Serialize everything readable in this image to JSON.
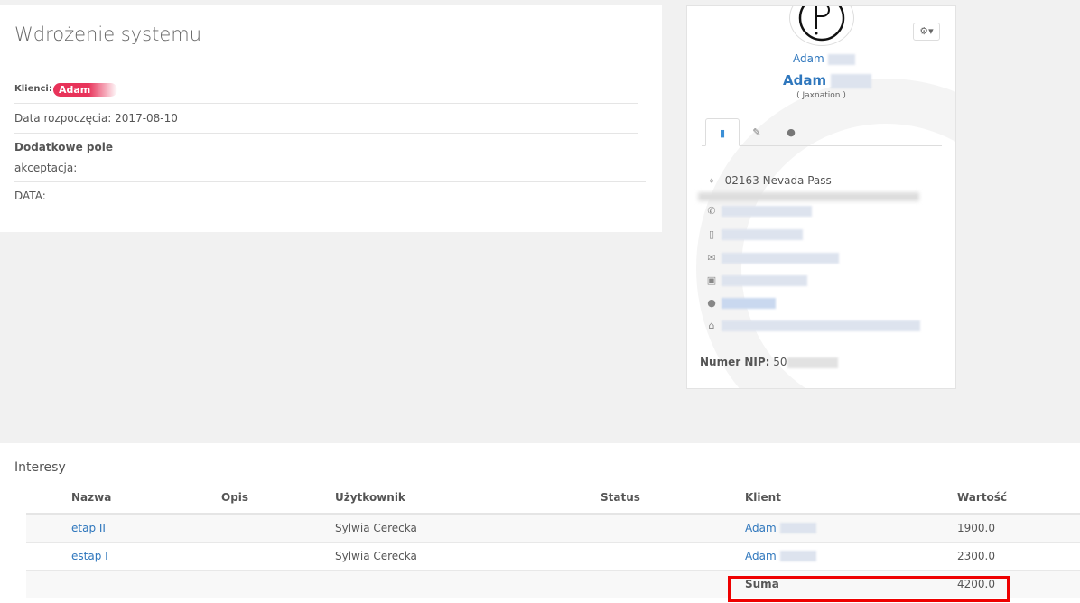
{
  "project": {
    "title": "Wdrożenie systemu",
    "clients_label": "Klienci:",
    "client_badge": "Adam",
    "start_date": "Data rozpoczęcia: 2017-08-10",
    "extra_heading": "Dodatkowe pole",
    "field_acceptance": "akceptacja:",
    "field_data": "DATA:"
  },
  "contact": {
    "first_name": "Adam",
    "full_name": "Adam",
    "company": "( Jaxnation )",
    "tabs": [
      {
        "icon": "building-icon"
      },
      {
        "icon": "edit-icon"
      },
      {
        "icon": "user-icon"
      }
    ],
    "address": "02163 Nevada Pass",
    "nip_label": "Numer NIP:",
    "nip_value": "50",
    "icons": [
      "map-marker-icon",
      "phone-icon",
      "mobile-icon",
      "envelope-icon",
      "fax-icon",
      "globe-icon",
      "bank-icon"
    ]
  },
  "interests": {
    "title": "Interesy",
    "columns": [
      "Nazwa",
      "Opis",
      "Użytkownik",
      "Status",
      "Klient",
      "Wartość"
    ],
    "rows": [
      {
        "name": "etap II",
        "desc": "",
        "user": "Sylwia Cerecka",
        "status": "",
        "client": "Adam",
        "value": "1900.0"
      },
      {
        "name": "estap I",
        "desc": "",
        "user": "Sylwia Cerecka",
        "status": "",
        "client": "Adam",
        "value": "2300.0"
      }
    ],
    "sum_label": "Suma",
    "sum_value": "4200.0"
  },
  "colors": {
    "accent": "#2f77bd",
    "badge": "#e8335a",
    "highlight": "#ee0000"
  }
}
